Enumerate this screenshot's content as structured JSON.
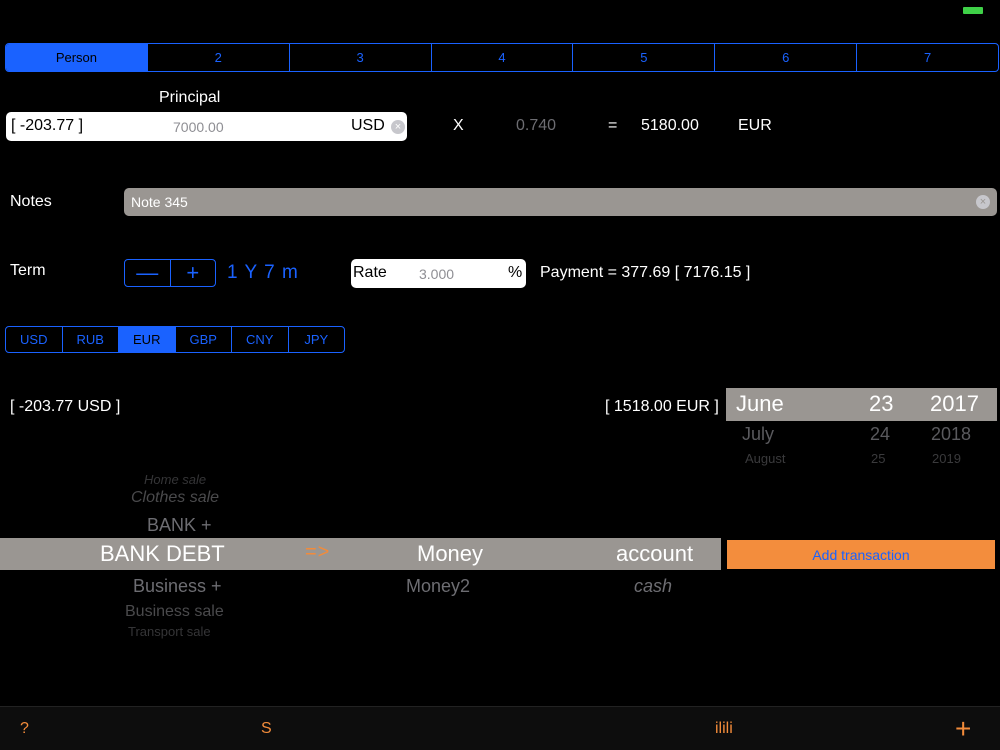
{
  "tabs": [
    {
      "label": "Person",
      "active": true
    },
    {
      "label": "2",
      "active": false
    },
    {
      "label": "3",
      "active": false
    },
    {
      "label": "4",
      "active": false
    },
    {
      "label": "5",
      "active": false
    },
    {
      "label": "6",
      "active": false
    },
    {
      "label": "7",
      "active": false
    }
  ],
  "principal": {
    "label": "Principal",
    "value": "[ -203.77 ]",
    "placeholder": "7000.00",
    "currency": "USD",
    "multiply_sign": "X",
    "rate": "0.740",
    "equals_sign": "=",
    "converted": "5180.00",
    "converted_currency": "EUR"
  },
  "notes": {
    "label": "Notes",
    "value": "Note 345"
  },
  "term": {
    "label": "Term",
    "minus": "—",
    "plus": "+",
    "value": "1 Y  7 m"
  },
  "rate_field": {
    "label": "Rate",
    "placeholder": "3.000",
    "unit": "%"
  },
  "payment": "Payment =  377.69 [ 7176.15 ]",
  "currencies": [
    {
      "label": "USD",
      "active": false
    },
    {
      "label": "RUB",
      "active": false
    },
    {
      "label": "EUR",
      "active": true
    },
    {
      "label": "GBP",
      "active": false
    },
    {
      "label": "CNY",
      "active": false
    },
    {
      "label": "JPY",
      "active": false
    }
  ],
  "balances": {
    "usd": "[ -203.77 USD ]",
    "eur": "[ 1518.00 EUR ]"
  },
  "date_picker": {
    "month": {
      "selected": "June",
      "next": "July",
      "next2": "August"
    },
    "day": {
      "selected": "23",
      "next": "24",
      "next2": "25"
    },
    "year": {
      "selected": "2017",
      "next": "2018",
      "next2": "2019"
    }
  },
  "category_picker": {
    "col1": {
      "above3": "Home sale",
      "above2": "Clothes sale",
      "above1": "BANK +",
      "selected": "BANK DEBT",
      "below1": "Business +",
      "below2": "Business sale",
      "below3": "Transport sale"
    },
    "arrow": "=>",
    "col2": {
      "selected": "Money",
      "below1": "Money2"
    },
    "col3": {
      "selected": "account",
      "below1": "cash"
    }
  },
  "add_button": "Add transaction",
  "toolbar": {
    "help": "?",
    "s": "S",
    "chart": "ilili",
    "plus": "+"
  }
}
